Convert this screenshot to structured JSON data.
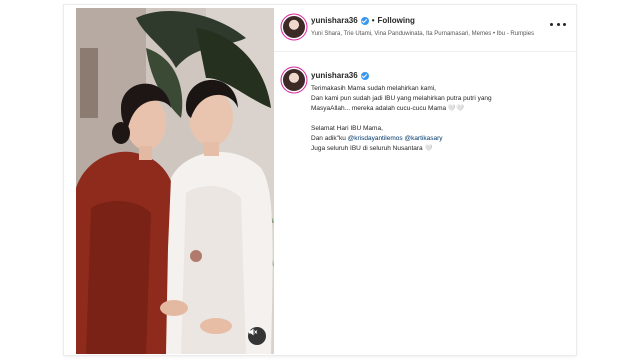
{
  "post": {
    "username": "yunishara36",
    "follow_label": "Following",
    "separator": "•",
    "tagged_line": "Yuni Shara, Trie Utami, Vina Panduwinata, Ita Purnamasari, Memes • Ibu - Rumpies",
    "caption": {
      "username": "yunishara36",
      "line1": "Terimakasih Mama sudah melahirkan kami,",
      "line2": "Dan kami pun sudah jadi IBU yang melahirkan putra putri yang",
      "line3": "MasyaAllah... mereka adalah cucu-cucu Mama 🤍🤍",
      "line4": "Selamat Hari IBU Mama,",
      "line5_prefix": "Dan adik\"ku ",
      "mention1": "@krisdayantilemos",
      "mention2": "@kartikasary",
      "line6": "Juga seluruh IBU di seluruh Nusantara 🤍"
    }
  },
  "icons": {
    "verified": "verified-badge-icon",
    "more": "more-options-icon",
    "mute": "audio-muted-icon"
  },
  "colors": {
    "verified_blue": "#3897f0",
    "mention_blue": "#00376b",
    "story_ring": "#d6249f"
  }
}
